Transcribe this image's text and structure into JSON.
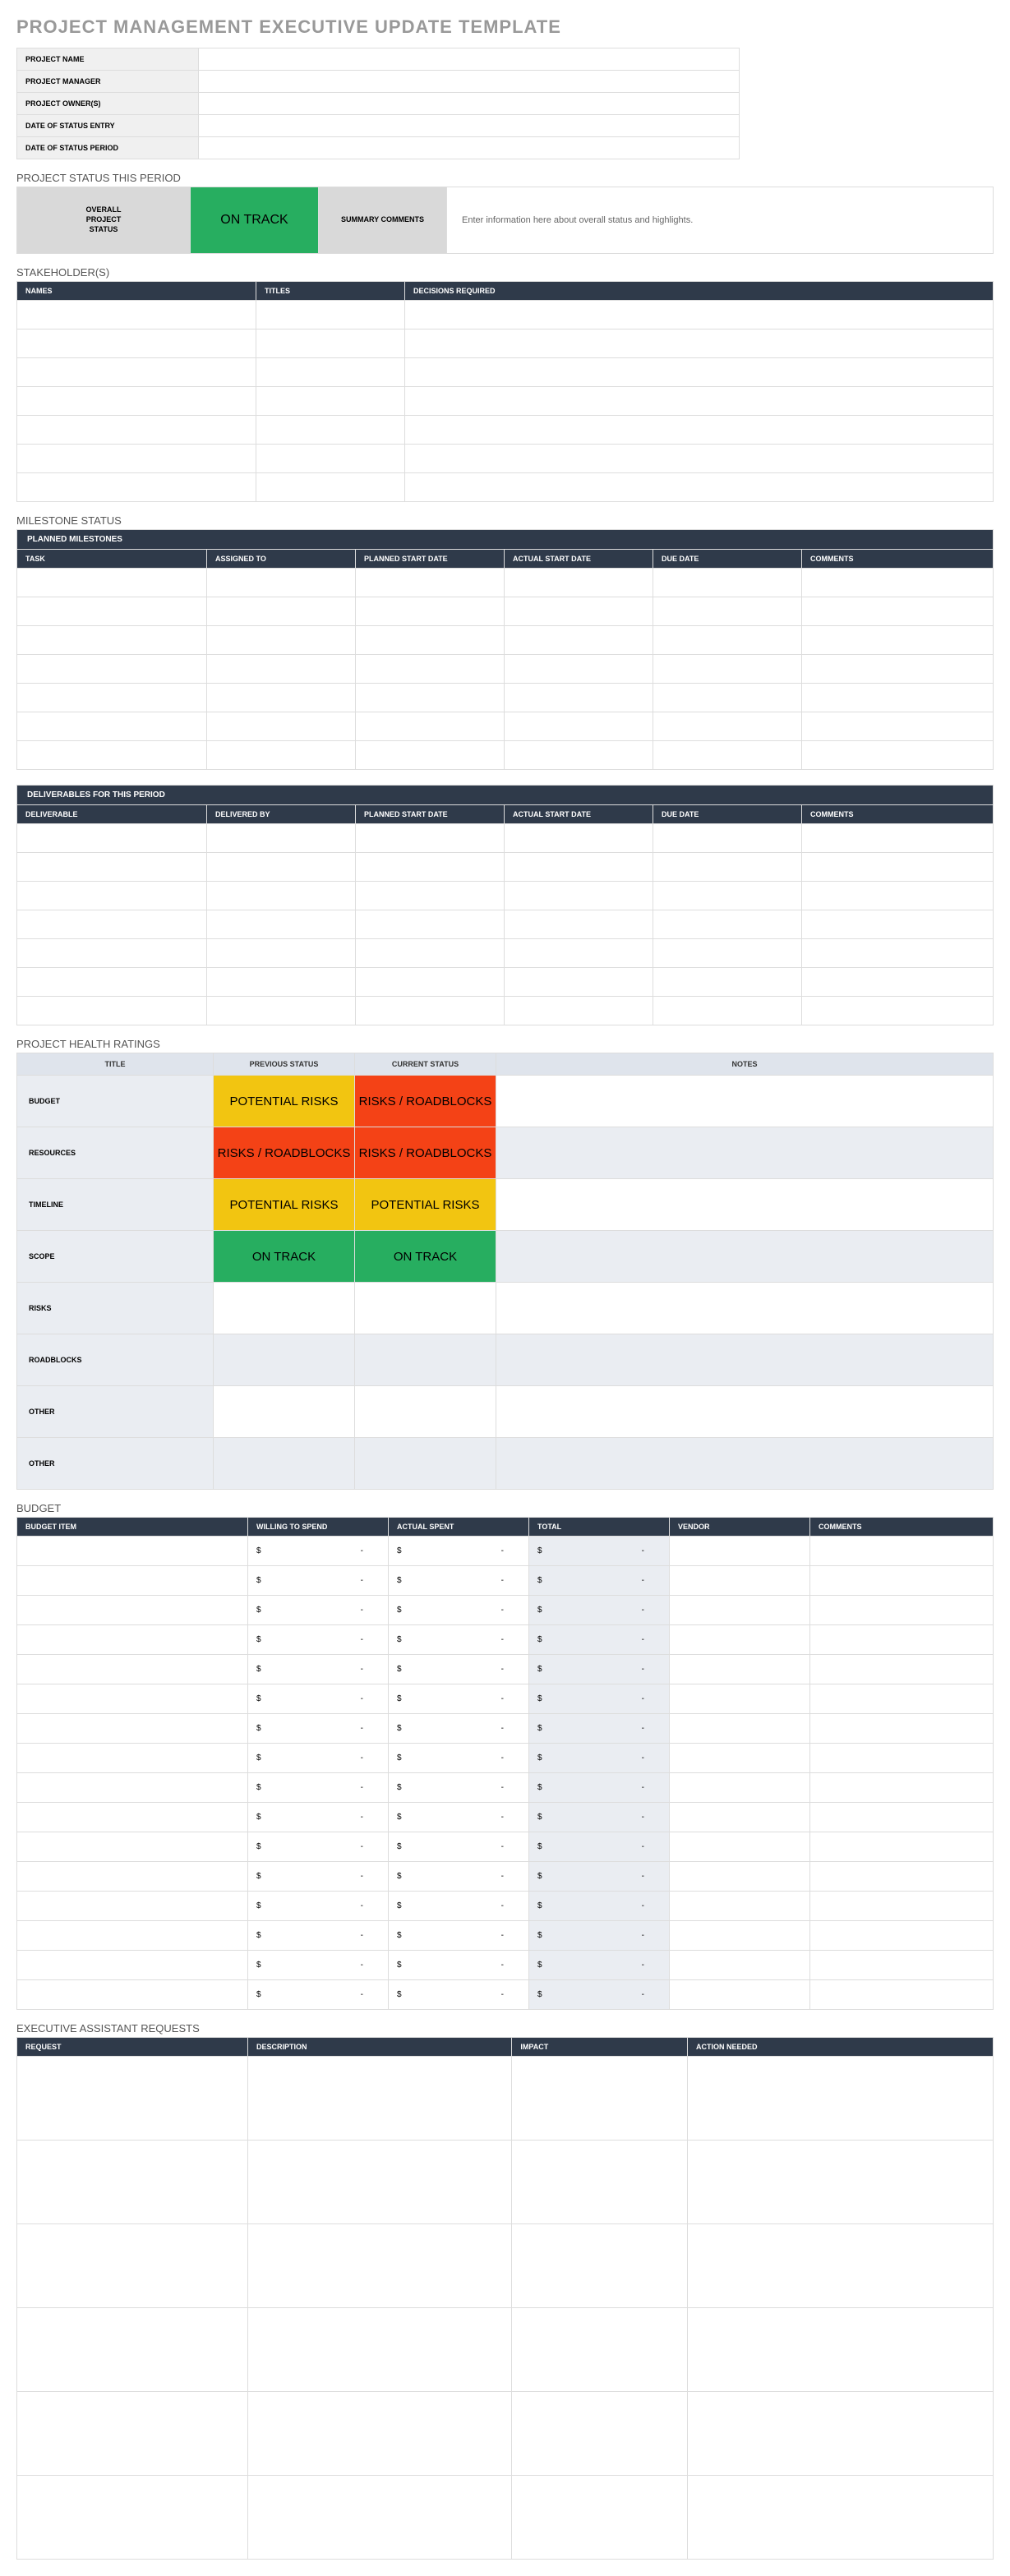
{
  "title": "PROJECT MANAGEMENT EXECUTIVE UPDATE TEMPLATE",
  "info_labels": [
    "PROJECT NAME",
    "PROJECT MANAGER",
    "PROJECT OWNER(S)",
    "DATE OF STATUS ENTRY",
    "DATE OF STATUS PERIOD"
  ],
  "status_section": {
    "heading": "PROJECT STATUS THIS PERIOD",
    "overall_label": "OVERALL\nPROJECT\nSTATUS",
    "value": "ON TRACK",
    "summary_label": "SUMMARY COMMENTS",
    "hint": "Enter information here about overall status and highlights."
  },
  "stakeholders": {
    "heading": "STAKEHOLDER(S)",
    "cols": [
      "NAMES",
      "TITLES",
      "DECISIONS REQUIRED"
    ],
    "rows": 7
  },
  "milestones": {
    "heading": "MILESTONE STATUS",
    "band": "PLANNED MILESTONES",
    "cols": [
      "TASK",
      "ASSIGNED TO",
      "PLANNED START DATE",
      "ACTUAL START DATE",
      "DUE DATE",
      "COMMENTS"
    ],
    "rows": 7
  },
  "deliverables": {
    "band": "DELIVERABLES FOR THIS PERIOD",
    "cols": [
      "DELIVERABLE",
      "DELIVERED BY",
      "PLANNED START DATE",
      "ACTUAL START DATE",
      "DUE DATE",
      "COMMENTS"
    ],
    "rows": 7
  },
  "health": {
    "heading": "PROJECT HEALTH RATINGS",
    "cols": [
      "TITLE",
      "PREVIOUS STATUS",
      "CURRENT STATUS",
      "NOTES"
    ],
    "rows": [
      {
        "label": "BUDGET",
        "prev": "POTENTIAL RISKS",
        "prev_c": "yellow",
        "curr": "RISKS / ROADBLOCKS",
        "curr_c": "red",
        "alt": false
      },
      {
        "label": "RESOURCES",
        "prev": "RISKS / ROADBLOCKS",
        "prev_c": "red",
        "curr": "RISKS / ROADBLOCKS",
        "curr_c": "red",
        "alt": true
      },
      {
        "label": "TIMELINE",
        "prev": "POTENTIAL RISKS",
        "prev_c": "yellow",
        "curr": "POTENTIAL RISKS",
        "curr_c": "yellow",
        "alt": false
      },
      {
        "label": "SCOPE",
        "prev": "ON TRACK",
        "prev_c": "green",
        "curr": "ON TRACK",
        "curr_c": "green",
        "alt": true
      },
      {
        "label": "RISKS",
        "prev": "",
        "prev_c": "",
        "curr": "",
        "curr_c": "",
        "alt": false
      },
      {
        "label": "ROADBLOCKS",
        "prev": "",
        "prev_c": "",
        "curr": "",
        "curr_c": "",
        "alt": true
      },
      {
        "label": "OTHER",
        "prev": "",
        "prev_c": "",
        "curr": "",
        "curr_c": "",
        "alt": false
      },
      {
        "label": "OTHER",
        "prev": "",
        "prev_c": "",
        "curr": "",
        "curr_c": "",
        "alt": true
      }
    ]
  },
  "budget": {
    "heading": "BUDGET",
    "cols": [
      "BUDGET ITEM",
      "WILLING TO SPEND",
      "ACTUAL SPENT",
      "TOTAL",
      "VENDOR",
      "COMMENTS"
    ],
    "currency": "$",
    "dash": "-",
    "rows": 16
  },
  "requests": {
    "heading": "EXECUTIVE ASSISTANT REQUESTS",
    "cols": [
      "REQUEST",
      "DESCRIPTION",
      "IMPACT",
      "ACTION NEEDED"
    ],
    "rows": 6
  }
}
